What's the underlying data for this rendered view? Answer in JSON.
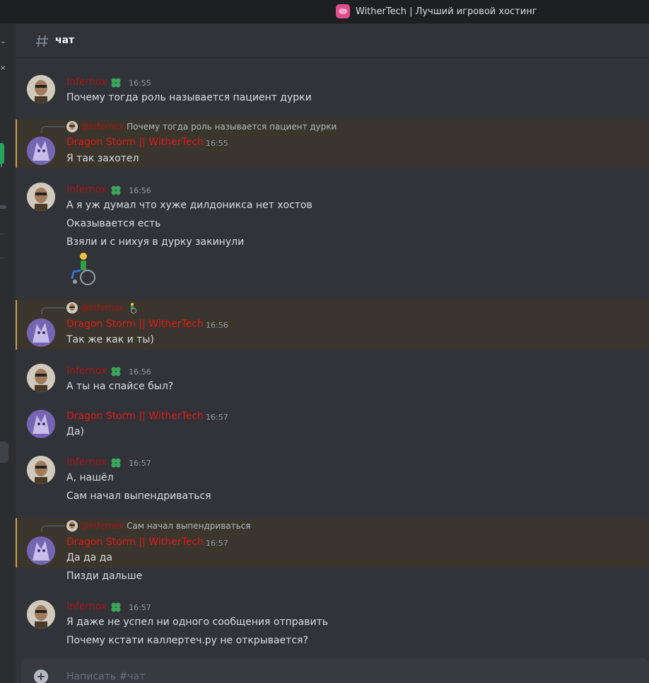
{
  "window": {
    "title": "WitherTech | Лучший игровой хостинг",
    "server_icon": "server-icon"
  },
  "channel": {
    "name": "чат",
    "icon": "hash-icon"
  },
  "colors": {
    "infernox": "#a81616",
    "dragon": "#e01919",
    "mention_bg": "#3a352d",
    "mention_bar": "#c9a24a",
    "badge": "#3ba55c"
  },
  "messages": [
    {
      "author": "Infernox",
      "time": "16:55",
      "lines": [
        "Почему тогда роль называется пациент дурки"
      ]
    },
    {
      "reply_to": {
        "name": "@Infernox",
        "text": "Почему тогда роль называется пациент дурки"
      },
      "author": "Dragon Storm || WitherTech",
      "time": "16:55",
      "lines": [
        "Я так захотел"
      ]
    },
    {
      "author": "Infernox",
      "time": "16:56",
      "lines": [
        "А я уж думал что хуже дилдоникса нет хостов",
        "Оказывается есть",
        "Взяли и с нихуя в дурку закинули"
      ],
      "sticker": "wheelchair-emoji"
    },
    {
      "reply_to": {
        "name": "@Infernox",
        "text": ""
      },
      "author": "Dragon Storm || WitherTech",
      "time": "16:56",
      "lines": [
        "Так же как и ты)"
      ]
    },
    {
      "author": "Infernox",
      "time": "16:56",
      "lines": [
        "А ты на спайсе был?"
      ]
    },
    {
      "author": "Dragon Storm || WitherTech",
      "time": "16:57",
      "lines": [
        "Да)"
      ]
    },
    {
      "author": "Infernox",
      "time": "16:57",
      "lines": [
        "А, нашёл",
        "Сам начал выпендриваться"
      ]
    },
    {
      "reply_to": {
        "name": "@Infernox",
        "text": "Сам начал выпендриваться"
      },
      "author": "Dragon Storm || WitherTech",
      "time": "16:57",
      "lines": [
        "Да да да"
      ]
    },
    {
      "lines": [
        "Пизди дальше"
      ]
    },
    {
      "author": "Infernox",
      "time": "16:57",
      "lines": [
        "Я даже не успел ни одного сообщения отправить",
        "Почему кстати каллертеч.ру не открывается?"
      ]
    }
  ],
  "composer": {
    "placeholder": "Написать #чат"
  }
}
